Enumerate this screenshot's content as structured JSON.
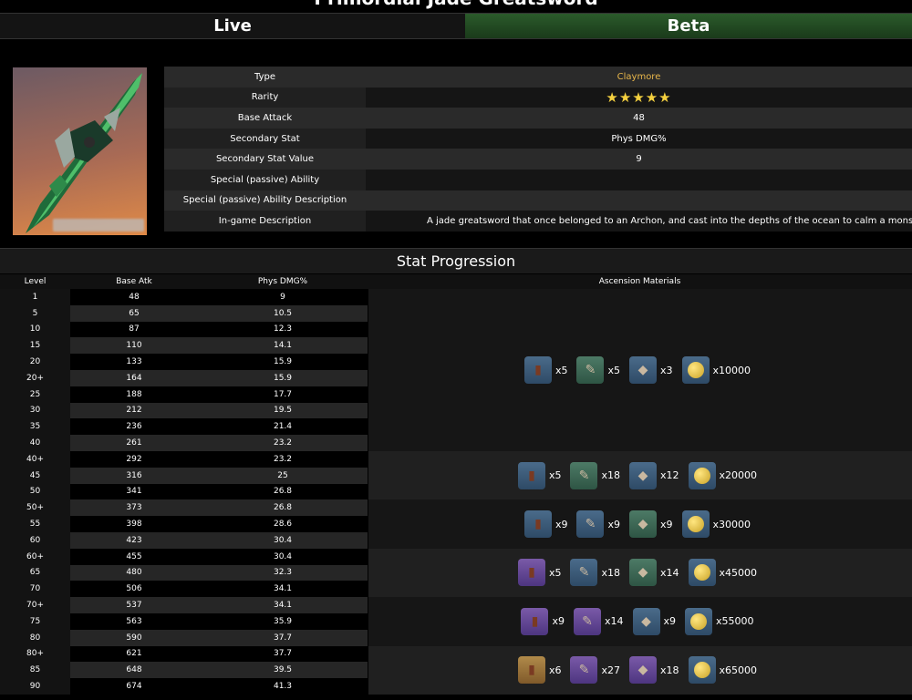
{
  "page_title": "Primordial Jade Greatsword",
  "tabs": [
    {
      "label": "Live"
    },
    {
      "label": "Beta"
    }
  ],
  "info": {
    "rows": [
      {
        "label": "Type",
        "value": "Claymore"
      },
      {
        "label": "Rarity",
        "value": "★★★★★"
      },
      {
        "label": "Base Attack",
        "value": "48"
      },
      {
        "label": "Secondary Stat",
        "value": "Phys DMG%"
      },
      {
        "label": "Secondary Stat Value",
        "value": "9"
      },
      {
        "label": "Special (passive) Ability",
        "value": ""
      },
      {
        "label": "Special (passive) Ability Description",
        "value": ""
      },
      {
        "label": "In-game Description",
        "value": "A jade greatsword that once belonged to an Archon, and cast into the depths of the ocean to calm a monst"
      }
    ]
  },
  "progression": {
    "title": "Stat Progression",
    "headers": [
      "Level",
      "Base Atk",
      "Phys DMG%",
      "Ascension Materials"
    ],
    "rows": [
      [
        "1",
        "48",
        "9"
      ],
      [
        "5",
        "65",
        "10.5"
      ],
      [
        "10",
        "87",
        "12.3"
      ],
      [
        "15",
        "110",
        "14.1"
      ],
      [
        "20",
        "133",
        "15.9"
      ],
      [
        "20+",
        "164",
        "15.9"
      ],
      [
        "25",
        "188",
        "17.7"
      ],
      [
        "30",
        "212",
        "19.5"
      ],
      [
        "35",
        "236",
        "21.4"
      ],
      [
        "40",
        "261",
        "23.2"
      ],
      [
        "40+",
        "292",
        "23.2"
      ],
      [
        "45",
        "316",
        "25"
      ],
      [
        "50",
        "341",
        "26.8"
      ],
      [
        "50+",
        "373",
        "26.8"
      ],
      [
        "55",
        "398",
        "28.6"
      ],
      [
        "60",
        "423",
        "30.4"
      ],
      [
        "60+",
        "455",
        "30.4"
      ],
      [
        "65",
        "480",
        "32.3"
      ],
      [
        "70",
        "506",
        "34.1"
      ],
      [
        "70+",
        "537",
        "34.1"
      ],
      [
        "75",
        "563",
        "35.9"
      ],
      [
        "80",
        "590",
        "37.7"
      ],
      [
        "80+",
        "621",
        "37.7"
      ],
      [
        "85",
        "648",
        "39.5"
      ],
      [
        "90",
        "674",
        "41.3"
      ]
    ],
    "materials": [
      {
        "items": [
          {
            "icon": "boss-drop-icon",
            "tint": "blue",
            "count": "x5"
          },
          {
            "icon": "elite-drop-icon",
            "tint": "green",
            "count": "x5"
          },
          {
            "icon": "common-drop-icon",
            "tint": "blue",
            "count": "x3"
          },
          {
            "icon": "mora-coin-icon",
            "tint": "coin",
            "count": "x10000"
          }
        ]
      },
      {
        "items": [
          {
            "icon": "boss-drop-icon",
            "tint": "blue",
            "count": "x5"
          },
          {
            "icon": "elite-drop-icon",
            "tint": "green",
            "count": "x18"
          },
          {
            "icon": "common-drop-icon",
            "tint": "blue",
            "count": "x12"
          },
          {
            "icon": "mora-coin-icon",
            "tint": "coin",
            "count": "x20000"
          }
        ]
      },
      {
        "items": [
          {
            "icon": "boss-drop-icon",
            "tint": "blue",
            "count": "x9"
          },
          {
            "icon": "elite-drop-icon",
            "tint": "blue",
            "count": "x9"
          },
          {
            "icon": "common-drop-icon",
            "tint": "green",
            "count": "x9"
          },
          {
            "icon": "mora-coin-icon",
            "tint": "coin",
            "count": "x30000"
          }
        ]
      },
      {
        "items": [
          {
            "icon": "boss-drop-icon",
            "tint": "purple",
            "count": "x5"
          },
          {
            "icon": "elite-drop-icon",
            "tint": "blue",
            "count": "x18"
          },
          {
            "icon": "common-drop-icon",
            "tint": "green",
            "count": "x14"
          },
          {
            "icon": "mora-coin-icon",
            "tint": "coin",
            "count": "x45000"
          }
        ]
      },
      {
        "items": [
          {
            "icon": "boss-drop-icon",
            "tint": "purple",
            "count": "x9"
          },
          {
            "icon": "elite-drop-icon",
            "tint": "purple",
            "count": "x14"
          },
          {
            "icon": "common-drop-icon",
            "tint": "blue",
            "count": "x9"
          },
          {
            "icon": "mora-coin-icon",
            "tint": "coin",
            "count": "x55000"
          }
        ]
      },
      {
        "items": [
          {
            "icon": "boss-drop-icon",
            "tint": "gold",
            "count": "x6"
          },
          {
            "icon": "elite-drop-icon",
            "tint": "purple",
            "count": "x27"
          },
          {
            "icon": "common-drop-icon",
            "tint": "purple",
            "count": "x18"
          },
          {
            "icon": "mora-coin-icon",
            "tint": "coin",
            "count": "x65000"
          }
        ]
      }
    ]
  },
  "colors": {
    "accent_gold": "#e8b64a",
    "star": "#f4d03f",
    "beta_tab": "#2b5b2b"
  }
}
